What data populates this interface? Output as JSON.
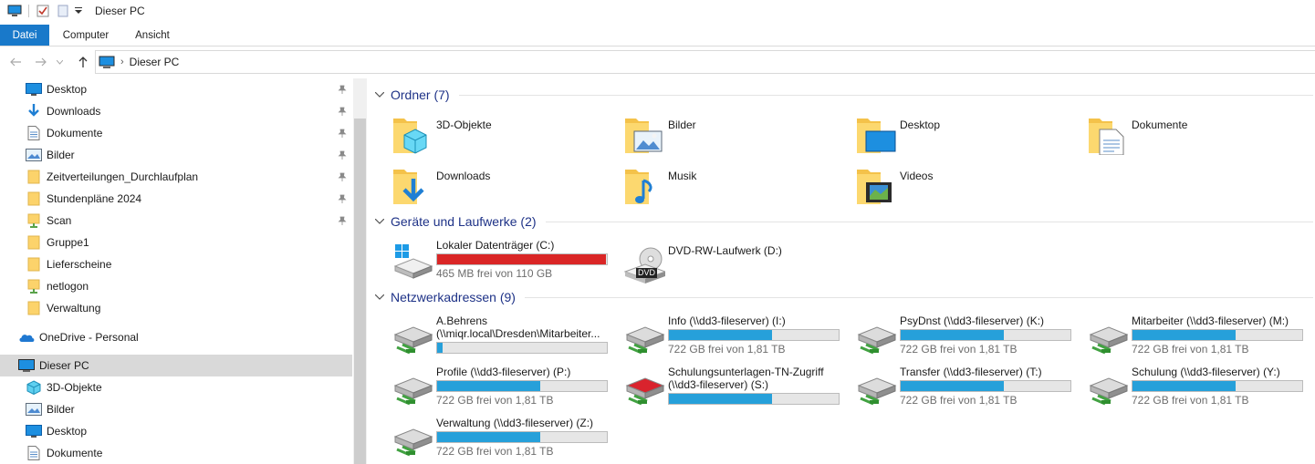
{
  "window": {
    "title": "Dieser PC"
  },
  "ribbon": {
    "tabs": [
      "Datei",
      "Computer",
      "Ansicht"
    ]
  },
  "address": {
    "crumb": "Dieser PC"
  },
  "nav": {
    "quick_access": [
      {
        "label": "Desktop",
        "icon": "desktop-icon",
        "pinned": true
      },
      {
        "label": "Downloads",
        "icon": "download-icon",
        "pinned": true
      },
      {
        "label": "Dokumente",
        "icon": "document-icon",
        "pinned": true
      },
      {
        "label": "Bilder",
        "icon": "pictures-icon",
        "pinned": true
      },
      {
        "label": "Zeitverteilungen_Durchlaufplan",
        "icon": "folder-icon",
        "pinned": true
      },
      {
        "label": "Stundenpläne 2024",
        "icon": "folder-icon",
        "pinned": true
      },
      {
        "label": "Scan",
        "icon": "network-folder-icon",
        "pinned": true
      },
      {
        "label": "Gruppe1",
        "icon": "folder-icon",
        "pinned": false
      },
      {
        "label": "Lieferscheine",
        "icon": "folder-icon",
        "pinned": false
      },
      {
        "label": "netlogon",
        "icon": "network-folder-icon",
        "pinned": false
      },
      {
        "label": "Verwaltung",
        "icon": "folder-icon",
        "pinned": false
      }
    ],
    "onedrive": "OneDrive - Personal",
    "this_pc": "Dieser PC",
    "this_pc_children": [
      {
        "label": "3D-Objekte",
        "icon": "3d-objects-icon"
      },
      {
        "label": "Bilder",
        "icon": "pictures-icon"
      },
      {
        "label": "Desktop",
        "icon": "desktop-icon"
      },
      {
        "label": "Dokumente",
        "icon": "document-icon"
      }
    ]
  },
  "groups": {
    "folders": {
      "title": "Ordner (7)",
      "items": [
        {
          "label": "3D-Objekte",
          "icon": "3d-objects-icon"
        },
        {
          "label": "Bilder",
          "icon": "pictures-icon"
        },
        {
          "label": "Desktop",
          "icon": "desktop-icon"
        },
        {
          "label": "Dokumente",
          "icon": "document-icon"
        },
        {
          "label": "Downloads",
          "icon": "download-icon"
        },
        {
          "label": "Musik",
          "icon": "music-icon"
        },
        {
          "label": "Videos",
          "icon": "video-icon"
        }
      ]
    },
    "devices": {
      "title": "Geräte und Laufwerke (2)",
      "items": [
        {
          "label": "Lokaler Datenträger (C:)",
          "free": "465 MB frei von 110 GB",
          "used_fraction": 0.996,
          "critical": true,
          "icon": "windows-drive-icon"
        },
        {
          "label": "DVD-RW-Laufwerk (D:)",
          "icon": "dvd-drive-icon",
          "dvd_badge": "DVD"
        }
      ]
    },
    "network": {
      "title": "Netzwerkadressen (9)",
      "items": [
        {
          "label": "A.Behrens",
          "label2": "(\\\\miqr.local\\Dresden\\Mitarbeiter...",
          "free": "",
          "used_fraction": 0.03,
          "icon": "network-drive-icon"
        },
        {
          "label": "Info (\\\\dd3-fileserver) (I:)",
          "label2": "",
          "free": "722 GB frei von 1,81 TB",
          "used_fraction": 0.61,
          "icon": "network-drive-icon"
        },
        {
          "label": "PsyDnst (\\\\dd3-fileserver) (K:)",
          "label2": "",
          "free": "722 GB frei von 1,81 TB",
          "used_fraction": 0.61,
          "icon": "network-drive-icon"
        },
        {
          "label": "Mitarbeiter (\\\\dd3-fileserver) (M:)",
          "label2": "",
          "free": "722 GB frei von 1,81 TB",
          "used_fraction": 0.61,
          "icon": "network-drive-icon"
        },
        {
          "label": "Profile (\\\\dd3-fileserver) (P:)",
          "label2": "",
          "free": "722 GB frei von 1,81 TB",
          "used_fraction": 0.61,
          "icon": "network-drive-icon"
        },
        {
          "label": "Schulungsunterlagen-TN-Zugriff",
          "label2": "(\\\\dd3-fileserver) (S:)",
          "free": "",
          "used_fraction": 0.61,
          "icon": "network-drive-disconnected-icon"
        },
        {
          "label": "Transfer (\\\\dd3-fileserver) (T:)",
          "label2": "",
          "free": "722 GB frei von 1,81 TB",
          "used_fraction": 0.61,
          "icon": "network-drive-icon"
        },
        {
          "label": "Schulung (\\\\dd3-fileserver) (Y:)",
          "label2": "",
          "free": "722 GB frei von 1,81 TB",
          "used_fraction": 0.61,
          "icon": "network-drive-icon"
        },
        {
          "label": "Verwaltung (\\\\dd3-fileserver) (Z:)",
          "label2": "",
          "free": "722 GB frei von 1,81 TB",
          "used_fraction": 0.61,
          "icon": "network-drive-icon"
        }
      ]
    }
  },
  "colors": {
    "accent": "#1979ca",
    "bar": "#26a0da",
    "bar_critical": "#da2626",
    "group_title": "#1e3287",
    "selection": "#d9d9d9"
  }
}
